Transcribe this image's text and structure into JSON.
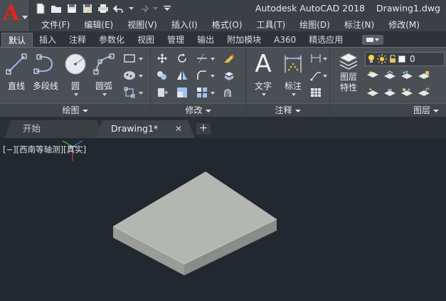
{
  "titlebar": {
    "app_name": "Autodesk AutoCAD 2018",
    "document": "Drawing1.dwg"
  },
  "menu": {
    "items": [
      "文件(F)",
      "编辑(E)",
      "视图(V)",
      "插入(I)",
      "格式(O)",
      "工具(T)",
      "绘图(D)",
      "标注(N)",
      "修改(M)"
    ]
  },
  "ribbon_tabs": {
    "items": [
      "默认",
      "插入",
      "注释",
      "参数化",
      "视图",
      "管理",
      "输出",
      "附加模块",
      "A360",
      "精选应用"
    ],
    "active": "默认"
  },
  "ribbon": {
    "draw_panel": {
      "title": "绘图",
      "tools": [
        "直线",
        "多段线",
        "圆",
        "圆弧"
      ]
    },
    "modify_panel": {
      "title": "修改"
    },
    "annotation_panel": {
      "title": "注释",
      "tools": [
        "文字",
        "标注"
      ]
    },
    "layers_panel": {
      "title": "图层",
      "tool_line1": "图层",
      "tool_line2": "特性",
      "current_layer": "0"
    }
  },
  "file_tabs": {
    "start": "开始",
    "document": "Drawing1*",
    "close_glyph": "✕",
    "add_glyph": "+"
  },
  "viewport": {
    "label": "[−][西南等轴测][真实]"
  },
  "colors": {
    "app_red": "#e0261f",
    "canvas": "#212830",
    "solid_top": "#b4b6b2",
    "solid_left": "#9a9c98",
    "solid_right": "#8a8c88"
  },
  "icons": {
    "app": "autocad-logo",
    "qat": [
      "new-file-icon",
      "open-folder-icon",
      "save-icon",
      "save-as-icon",
      "print-icon",
      "undo-icon",
      "redo-icon",
      "customize-qat-icon"
    ]
  }
}
